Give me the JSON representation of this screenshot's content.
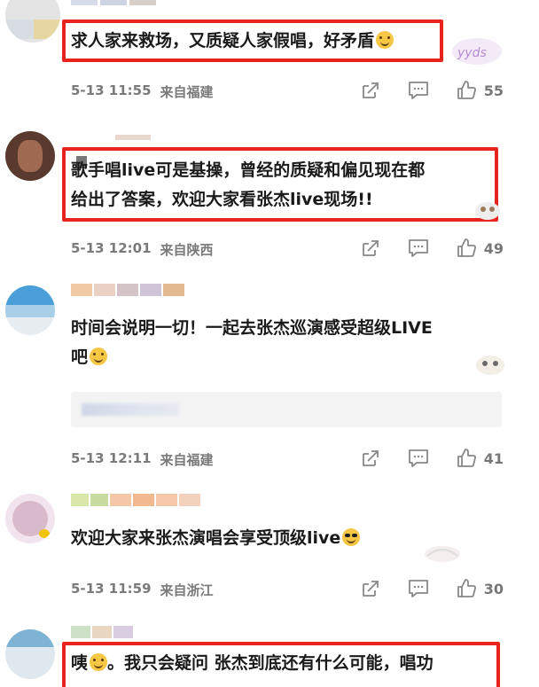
{
  "comments": [
    {
      "text_lines": [
        "求人家来救场，又质疑人家假唱，好矛盾"
      ],
      "emoji": "grinning-emoji",
      "date": "5-13 11:55",
      "location": "来自福建",
      "likes": "55"
    },
    {
      "text_lines": [
        "歌手唱live可是基操，曾经的质疑和偏见现在都",
        "给出了答案，欢迎大家看张杰live现场!!"
      ],
      "date": "5-13 12:01",
      "location": "来自陕西",
      "likes": "49"
    },
    {
      "text_lines": [
        "时间会说明一切！一起去张杰巡演感受超级LIVE",
        "吧"
      ],
      "emoji": "laughing-emoji",
      "date": "5-13 12:11",
      "location": "来自福建",
      "likes": "41"
    },
    {
      "text_lines": [
        "欢迎大家来张杰演唱会享受顶级live"
      ],
      "emoji": "sunglasses-emoji",
      "date": "5-13 11:59",
      "location": "来自浙江",
      "likes": "30"
    },
    {
      "text_lines": [
        "咦",
        "。我只会疑问 张杰到底还有什么可能，唱功"
      ],
      "emoji": "sweat-emoji"
    }
  ],
  "watermark": "yyds",
  "icons": {
    "share": "share-icon",
    "comment": "comment-icon",
    "like": "thumbs-up-icon"
  },
  "colors": {
    "highlight": "#e8231b",
    "meta_text": "#7a7a7a"
  }
}
